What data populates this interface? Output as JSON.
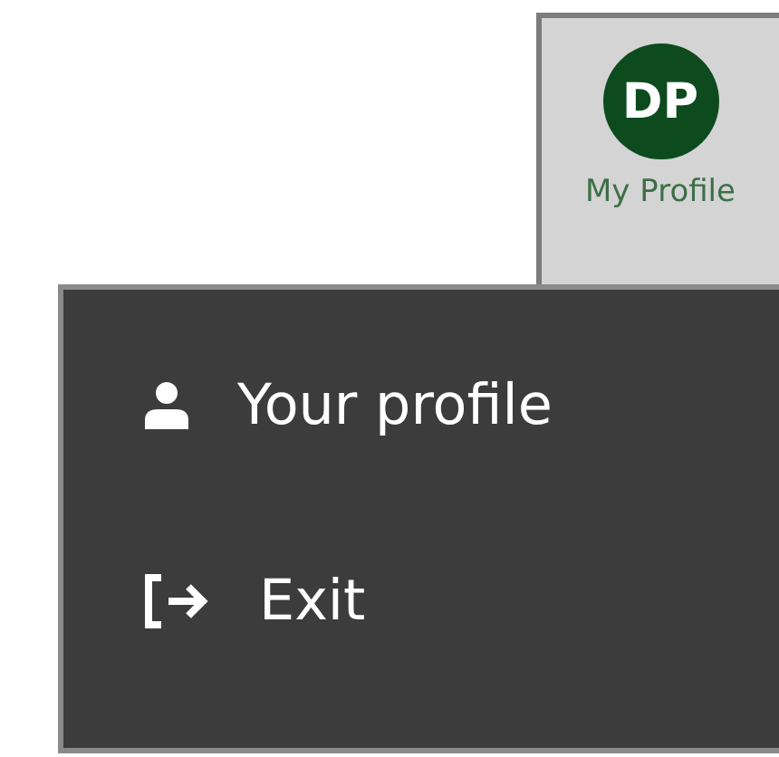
{
  "profile_button": {
    "initials": "DP",
    "label": "My Profile"
  },
  "menu": {
    "items": [
      {
        "kind": "profile",
        "label": "Your profile"
      },
      {
        "kind": "exit",
        "label": "Exit"
      }
    ]
  }
}
